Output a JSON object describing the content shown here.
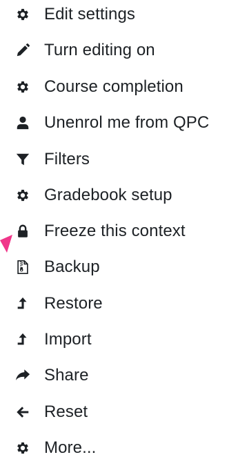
{
  "menu": {
    "items": [
      {
        "label": "Edit settings",
        "icon": "gear-icon"
      },
      {
        "label": "Turn editing on",
        "icon": "pencil-icon"
      },
      {
        "label": "Course completion",
        "icon": "gear-icon"
      },
      {
        "label": "Unenrol me from QPC",
        "icon": "user-icon"
      },
      {
        "label": "Filters",
        "icon": "filter-icon"
      },
      {
        "label": "Gradebook setup",
        "icon": "gear-icon"
      },
      {
        "label": "Freeze this context",
        "icon": "lock-icon"
      },
      {
        "label": "Backup",
        "icon": "file-archive-icon"
      },
      {
        "label": "Restore",
        "icon": "level-up-icon"
      },
      {
        "label": "Import",
        "icon": "level-up-icon"
      },
      {
        "label": "Share",
        "icon": "share-icon"
      },
      {
        "label": "Reset",
        "icon": "arrow-left-icon"
      },
      {
        "label": "More...",
        "icon": "gear-icon"
      }
    ]
  },
  "colors": {
    "text": "#1d2125",
    "icon": "#1d2125",
    "pointer": "#f0368a",
    "background": "#ffffff"
  }
}
